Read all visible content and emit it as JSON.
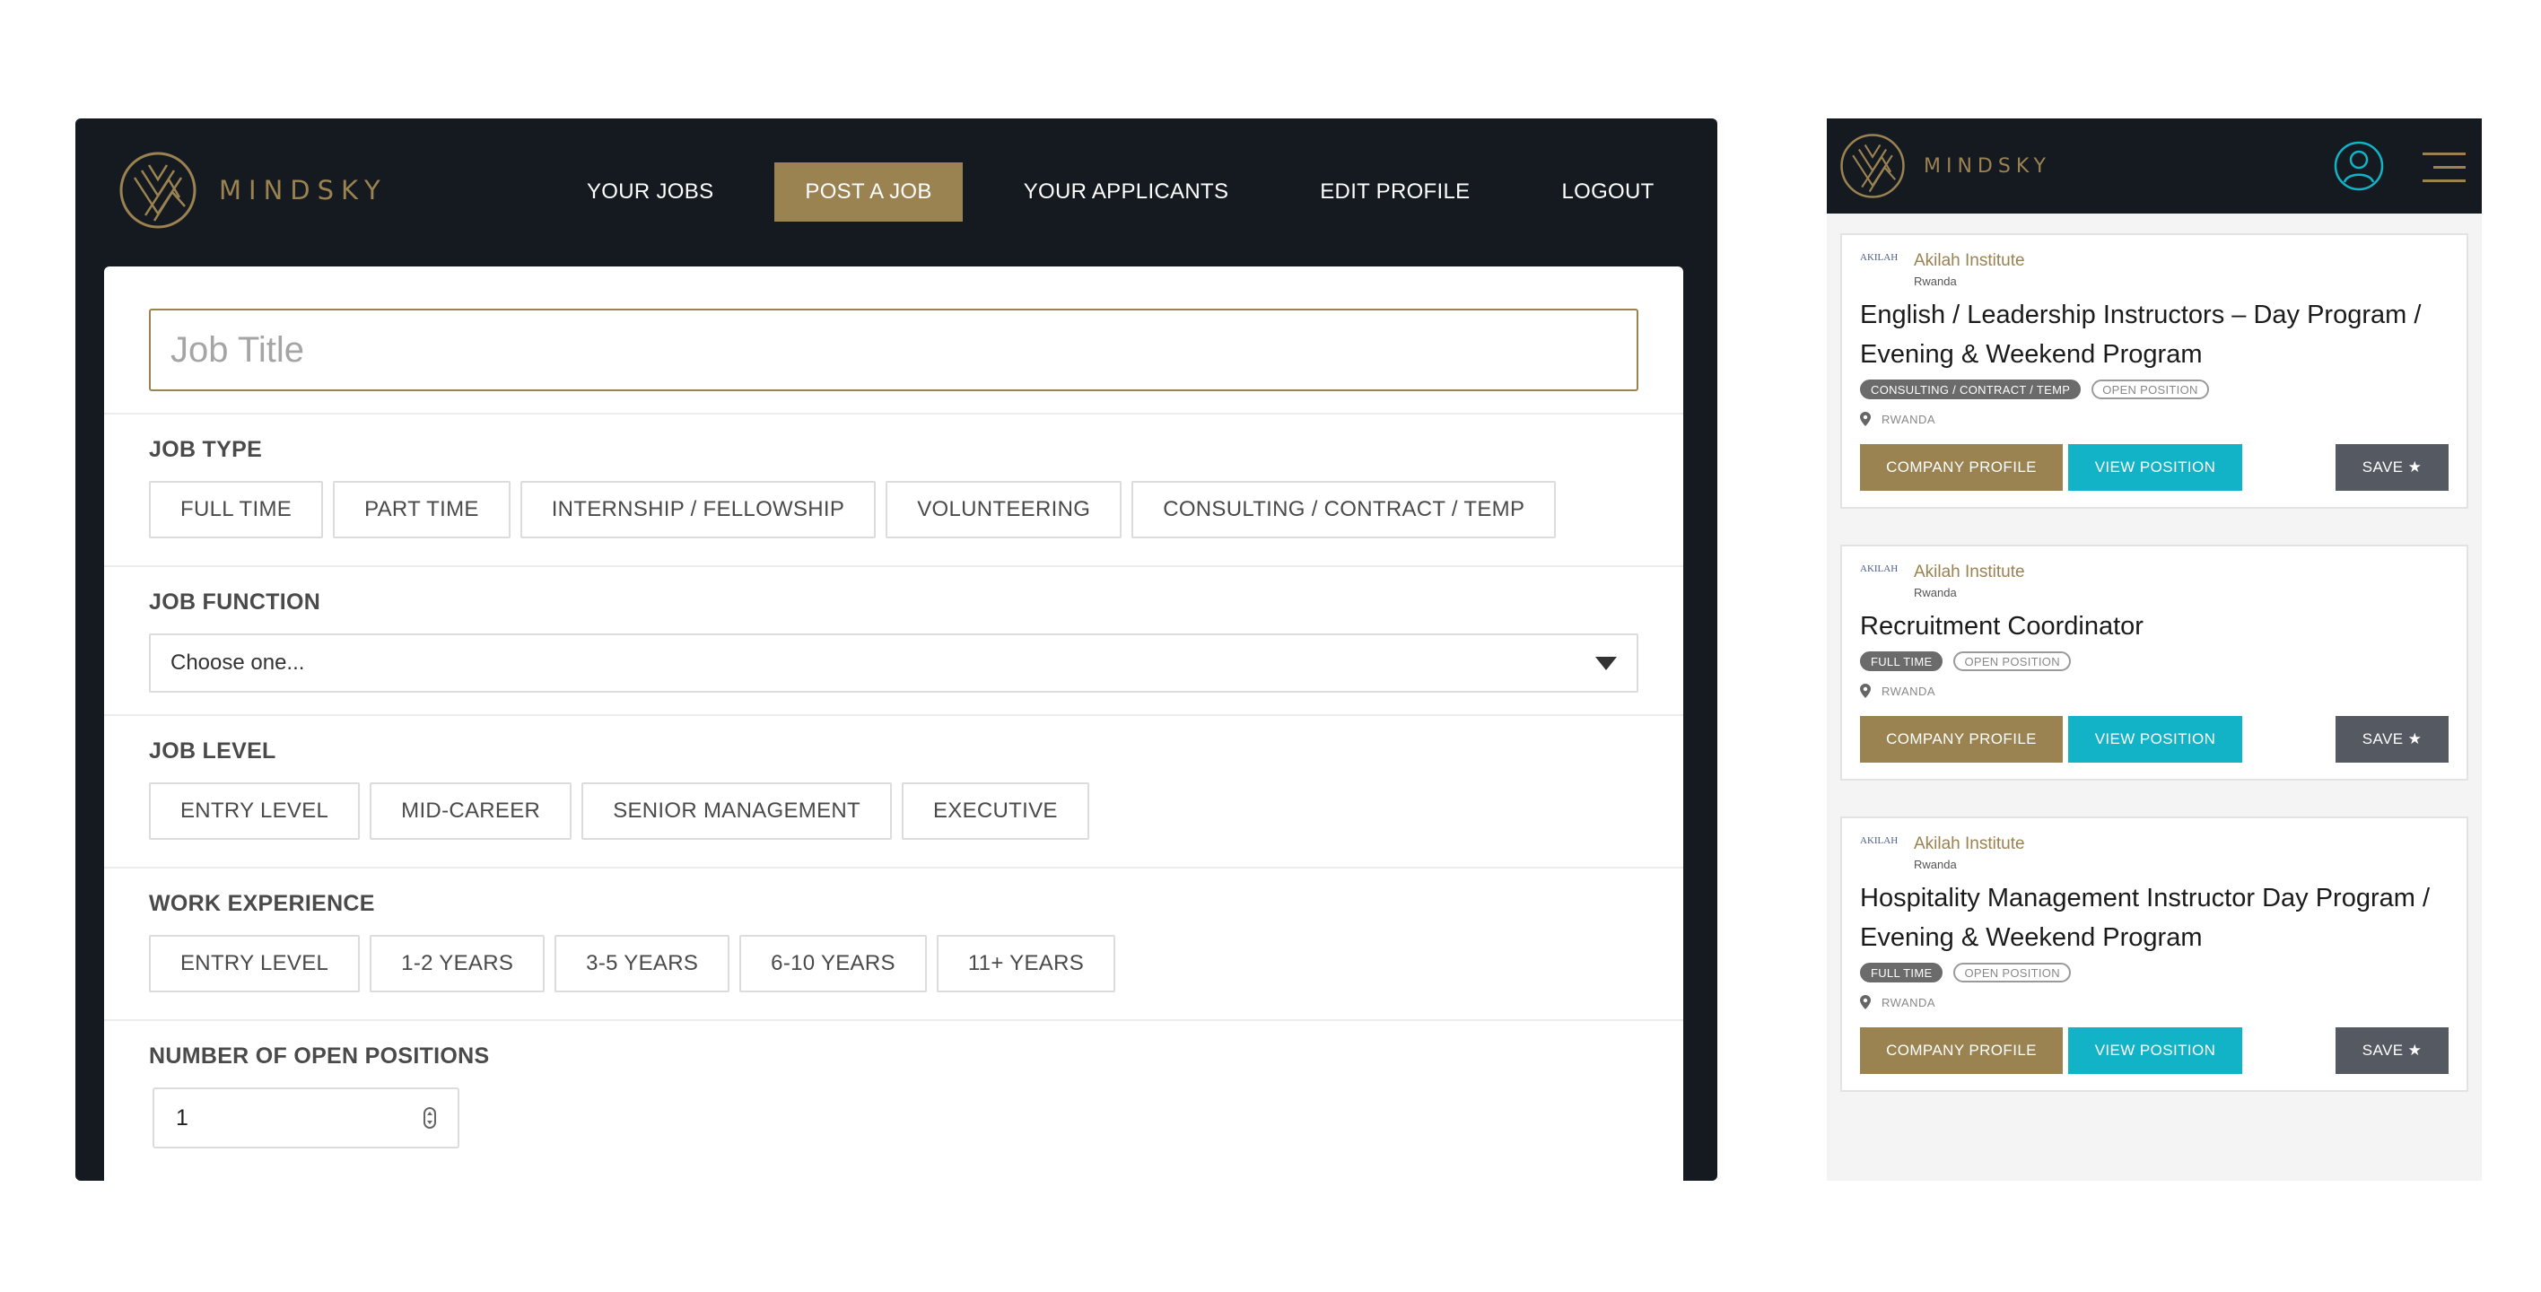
{
  "brand": {
    "name": "MINDSKY",
    "accent": "#9a8251",
    "dark": "#151a21",
    "teal": "#12b3c7"
  },
  "desktop": {
    "nav": [
      {
        "label": "YOUR JOBS",
        "active": false
      },
      {
        "label": "POST A JOB",
        "active": true
      },
      {
        "label": "YOUR APPLICANTS",
        "active": false
      },
      {
        "label": "EDIT PROFILE",
        "active": false
      },
      {
        "label": "LOGOUT",
        "active": false
      }
    ],
    "form": {
      "job_title_placeholder": "Job Title",
      "job_type": {
        "label": "JOB TYPE",
        "options": [
          "FULL TIME",
          "PART TIME",
          "INTERNSHIP / FELLOWSHIP",
          "VOLUNTEERING",
          "CONSULTING / CONTRACT / TEMP"
        ]
      },
      "job_function": {
        "label": "JOB FUNCTION",
        "selected": "Choose one..."
      },
      "job_level": {
        "label": "JOB LEVEL",
        "options": [
          "ENTRY LEVEL",
          "MID-CAREER",
          "SENIOR MANAGEMENT",
          "EXECUTIVE"
        ]
      },
      "work_experience": {
        "label": "WORK EXPERIENCE",
        "options": [
          "ENTRY LEVEL",
          "1-2 YEARS",
          "3-5 YEARS",
          "6-10 YEARS",
          "11+ YEARS"
        ]
      },
      "open_positions": {
        "label": "NUMBER OF OPEN POSITIONS",
        "value": "1"
      }
    }
  },
  "mobile": {
    "jobs": [
      {
        "company_logo_text": "AKILAH",
        "company": "Akilah Institute",
        "company_location": "Rwanda",
        "title": "English / Leadership Instructors – Day Program / Evening & Weekend Program",
        "tags": [
          "CONSULTING / CONTRACT / TEMP",
          "OPEN POSITION"
        ],
        "location": "RWANDA",
        "buttons": {
          "company": "COMPANY PROFILE",
          "view": "VIEW POSITION",
          "save": "SAVE ★"
        }
      },
      {
        "company_logo_text": "AKILAH",
        "company": "Akilah Institute",
        "company_location": "Rwanda",
        "title": "Recruitment Coordinator",
        "tags": [
          "FULL TIME",
          "OPEN POSITION"
        ],
        "location": "RWANDA",
        "buttons": {
          "company": "COMPANY PROFILE",
          "view": "VIEW POSITION",
          "save": "SAVE ★"
        }
      },
      {
        "company_logo_text": "AKILAH",
        "company": "Akilah Institute",
        "company_location": "Rwanda",
        "title": "Hospitality Management Instructor Day Program / Evening & Weekend Program",
        "tags": [
          "FULL TIME",
          "OPEN POSITION"
        ],
        "location": "RWANDA",
        "buttons": {
          "company": "COMPANY PROFILE",
          "view": "VIEW POSITION",
          "save": "SAVE ★"
        }
      }
    ]
  }
}
